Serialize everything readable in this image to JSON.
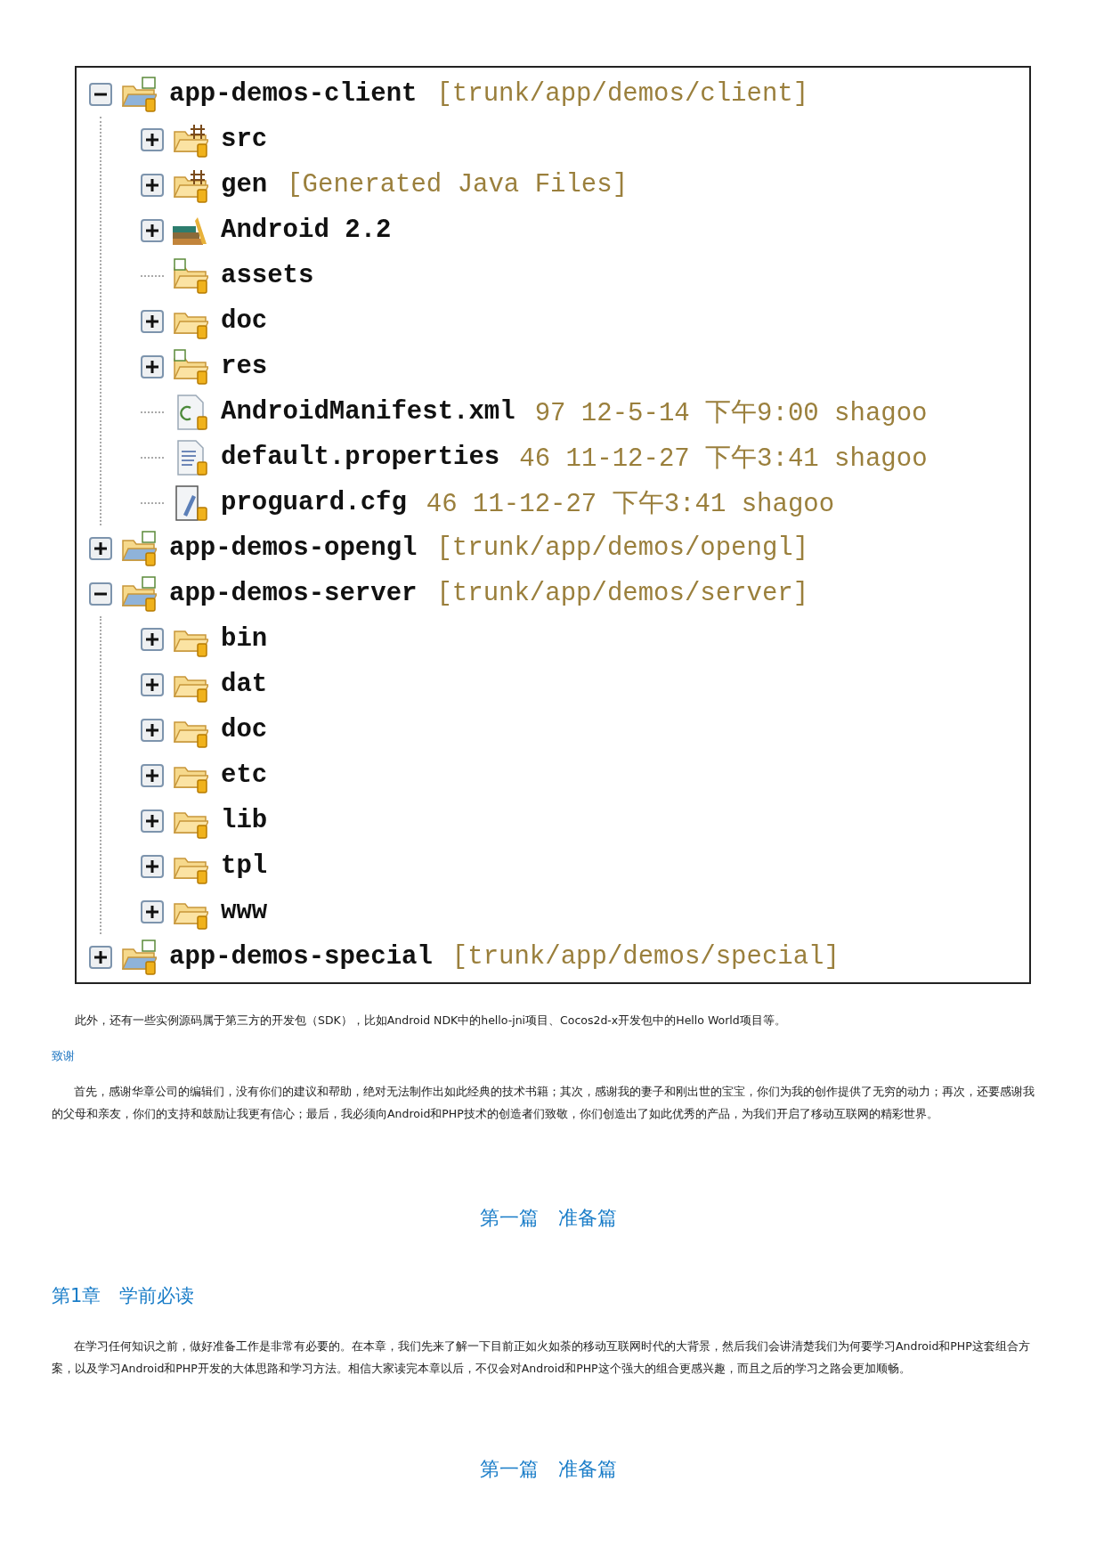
{
  "tree": {
    "nodes": [
      {
        "kind": "project",
        "name": "app-demos-client",
        "decoration": "[trunk/app/demos/client]",
        "expanded": true,
        "children": [
          {
            "kind": "source-folder",
            "name": "src",
            "expanded": false
          },
          {
            "kind": "source-folder",
            "name": "gen",
            "decoration": "[Generated Java Files]",
            "expanded": false
          },
          {
            "kind": "library",
            "name": "Android 2.2",
            "expanded": false
          },
          {
            "kind": "shared-folder",
            "name": "assets"
          },
          {
            "kind": "folder",
            "name": "doc",
            "expanded": false
          },
          {
            "kind": "shared-folder",
            "name": "res",
            "expanded": false
          },
          {
            "kind": "xml-file",
            "name": "AndroidManifest.xml",
            "decoration": "97  12-5-14 下午9:00  shagoo"
          },
          {
            "kind": "text-file",
            "name": "default.properties",
            "decoration": "46  11-12-27 下午3:41  shagoo"
          },
          {
            "kind": "config-file",
            "name": "proguard.cfg",
            "decoration": "46  11-12-27 下午3:41  shagoo"
          }
        ]
      },
      {
        "kind": "project",
        "name": "app-demos-opengl",
        "decoration": "[trunk/app/demos/opengl]",
        "expanded": false
      },
      {
        "kind": "project",
        "name": "app-demos-server",
        "decoration": "[trunk/app/demos/server]",
        "expanded": true,
        "children": [
          {
            "kind": "folder",
            "name": "bin",
            "expanded": false
          },
          {
            "kind": "folder",
            "name": "dat",
            "expanded": false
          },
          {
            "kind": "folder",
            "name": "doc",
            "expanded": false
          },
          {
            "kind": "folder",
            "name": "etc",
            "expanded": false
          },
          {
            "kind": "folder",
            "name": "lib",
            "expanded": false
          },
          {
            "kind": "folder",
            "name": "tpl",
            "expanded": false
          },
          {
            "kind": "folder",
            "name": "www",
            "expanded": false
          }
        ]
      },
      {
        "kind": "project",
        "name": "app-demos-special",
        "decoration": "[trunk/app/demos/special]",
        "expanded": false
      }
    ]
  },
  "note": "此外，还有一些实例源码属于第三方的开发包（SDK），比如Android NDK中的hello-jni项目、Cocos2d-x开发包中的Hello World项目等。",
  "acknowledgement_heading": "致谢",
  "acknowledgement": "首先，感谢华章公司的编辑们，没有你们的建议和帮助，绝对无法制作出如此经典的技术书籍；其次，感谢我的妻子和刚出世的宝宝，你们为我的创作提供了无穷的动力；再次，还要感谢我的父母和亲友，你们的支持和鼓励让我更有信心；最后，我必须向Android和PHP技术的创造者们致敬，你们创造出了如此优秀的产品，为我们开启了移动互联网的精彩世界。",
  "part_heading": "第一篇　准备篇",
  "chapter_heading": "第1章　学前必读",
  "chapter_intro": "在学习任何知识之前，做好准备工作是非常有必要的。在本章，我们先来了解一下目前正如火如荼的移动互联网时代的大背景，然后我们会讲清楚我们为何要学习Android和PHP这套组合方案，以及学习Android和PHP开发的大体思路和学习方法。相信大家读完本章以后，不仅会对Android和PHP这个强大的组合更感兴趣，而且之后的学习之路会更加顺畅。",
  "footer_heading": "第一篇　准备篇"
}
